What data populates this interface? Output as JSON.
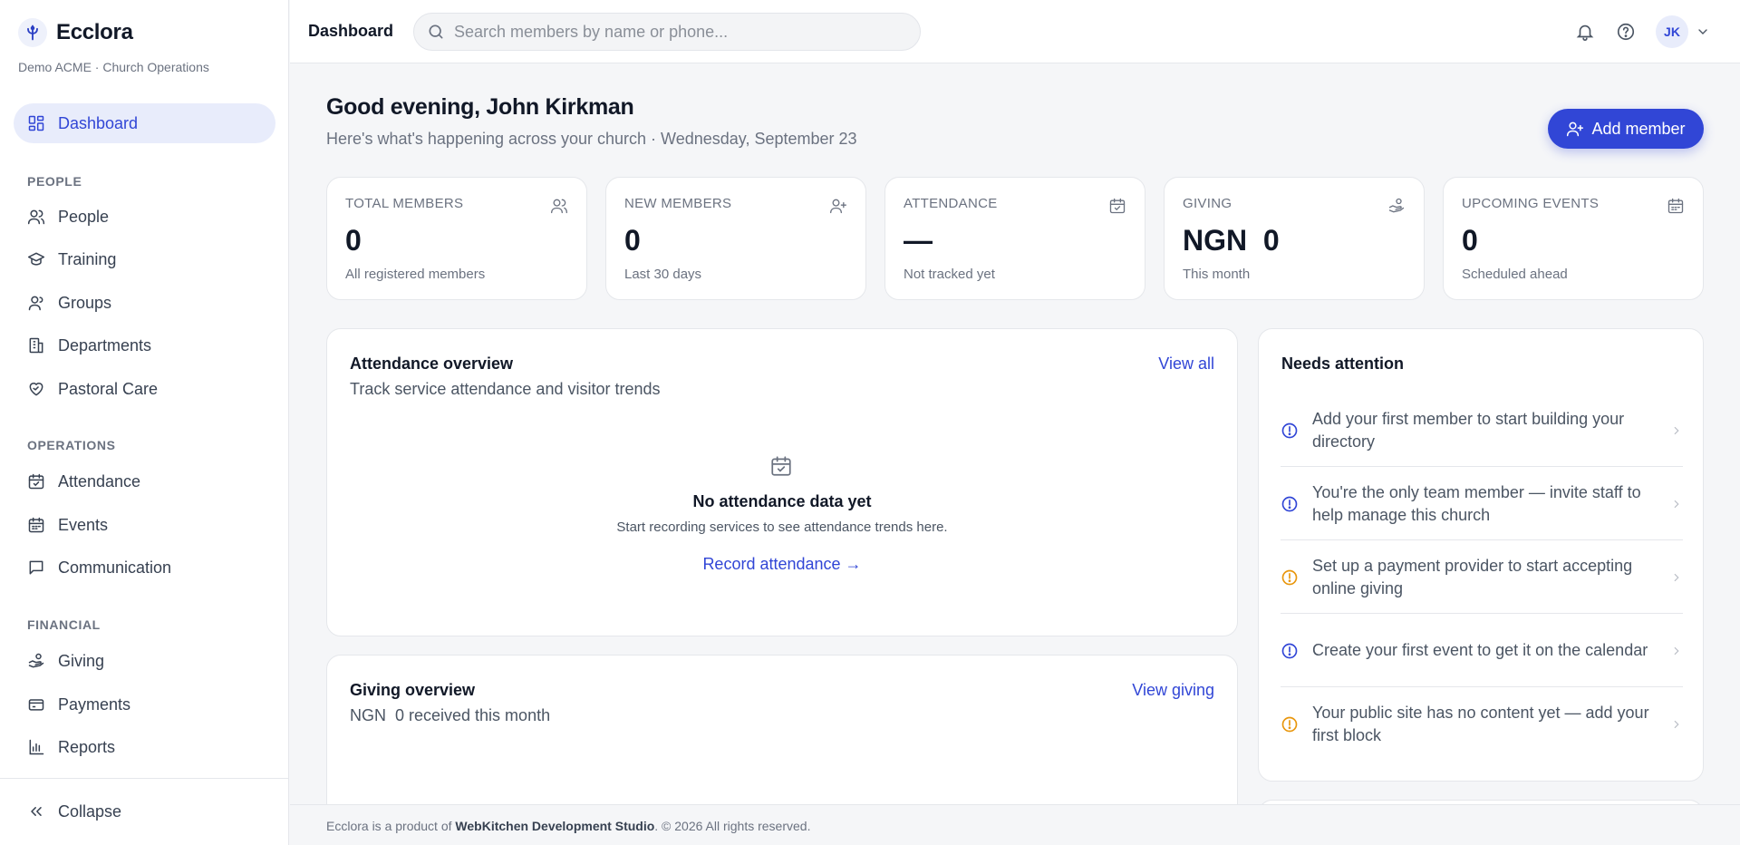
{
  "brand": {
    "name": "Ecclora",
    "subtitle": "Demo ACME · Church Operations"
  },
  "sidebar": {
    "dashboard": "Dashboard",
    "section_people": "PEOPLE",
    "people_items": [
      "People",
      "Training",
      "Groups",
      "Departments",
      "Pastoral Care"
    ],
    "section_operations": "OPERATIONS",
    "operations_items": [
      "Attendance",
      "Events",
      "Communication"
    ],
    "section_financial": "FINANCIAL",
    "financial_items": [
      "Giving",
      "Payments",
      "Reports"
    ],
    "collapse": "Collapse"
  },
  "header": {
    "title": "Dashboard",
    "search_placeholder": "Search members by name or phone...",
    "avatar_initials": "JK"
  },
  "main": {
    "greeting": "Good evening, John Kirkman",
    "subtitle": "Here's what's happening across your church · Wednesday, September 23",
    "add_member": "Add member",
    "stats": [
      {
        "label": "TOTAL MEMBERS",
        "value": "0",
        "note": "All registered members",
        "icon": "users-icon"
      },
      {
        "label": "NEW MEMBERS",
        "value": "0",
        "note": "Last 30 days",
        "icon": "user-plus-icon"
      },
      {
        "label": "ATTENDANCE",
        "value": "—",
        "note": "Not tracked yet",
        "icon": "calendar-check-icon"
      },
      {
        "label": "GIVING",
        "value": "NGN  0",
        "note": "This month",
        "icon": "giving-hand-icon"
      },
      {
        "label": "UPCOMING EVENTS",
        "value": "0",
        "note": "Scheduled ahead",
        "icon": "calendar-icon"
      }
    ],
    "attendance": {
      "title": "Attendance overview",
      "subtitle": "Track service attendance and visitor trends",
      "link": "View all",
      "empty_title": "No attendance data yet",
      "empty_desc": "Start recording services to see attendance trends here.",
      "empty_cta": "Record attendance →"
    },
    "giving": {
      "title": "Giving overview",
      "subtitle": "NGN  0 received this month",
      "link": "View giving"
    },
    "attention": {
      "title": "Needs attention",
      "items": [
        {
          "text": "Add your first member to start building your directory",
          "color": "#3146d6"
        },
        {
          "text": "You're the only team member — invite staff to help manage this church",
          "color": "#3146d6"
        },
        {
          "text": "Set up a payment provider to start accepting online giving",
          "color": "#e8960c"
        },
        {
          "text": "Create your first event to get it on the calendar",
          "color": "#3146d6"
        },
        {
          "text": "Your public site has no content yet — add your first block",
          "color": "#e8960c"
        }
      ]
    }
  },
  "footer": {
    "prefix": "Ecclora is a product of",
    "company": "WebKitchen Development Studio",
    "suffix": ". © 2026 All rights reserved."
  },
  "colors": {
    "accent": "#3146d6",
    "warning": "#e8960c",
    "background": "#f5f6f8"
  }
}
